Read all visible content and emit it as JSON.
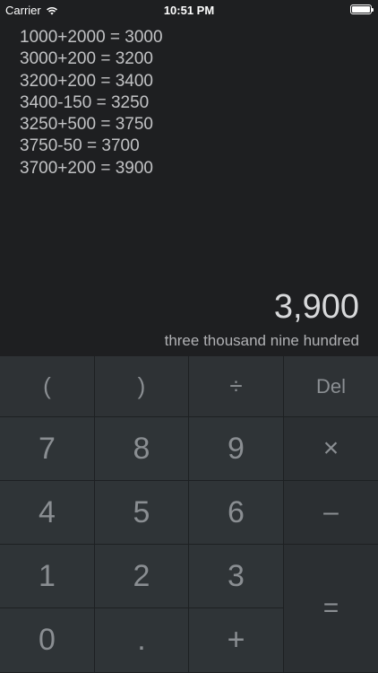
{
  "status_bar": {
    "carrier": "Carrier",
    "time": "10:51 PM",
    "wifi_icon": "wifi-icon",
    "battery_icon": "battery-icon",
    "battery_level_percent": 100
  },
  "history": [
    "1000+2000 = 3000",
    "3000+200 = 3200",
    "3200+200 = 3400",
    "3400-150 = 3250",
    "3250+500 = 3750",
    "3750-50 = 3700",
    "3700+200 = 3900"
  ],
  "result": {
    "value": "3,900",
    "words": "three thousand nine hundred"
  },
  "keypad": {
    "open_paren": "(",
    "close_paren": ")",
    "divide": "÷",
    "delete": "Del",
    "seven": "7",
    "eight": "8",
    "nine": "9",
    "multiply": "×",
    "four": "4",
    "five": "5",
    "six": "6",
    "minus": "–",
    "one": "1",
    "two": "2",
    "three": "3",
    "equals": "=",
    "zero": "0",
    "decimal": ".",
    "plus": "+"
  },
  "colors": {
    "background": "#1e1f21",
    "keypad_background": "#2f3437",
    "text_primary": "#d8d9db",
    "text_secondary": "#c2c3c5",
    "key_text": "#8a8e92"
  }
}
